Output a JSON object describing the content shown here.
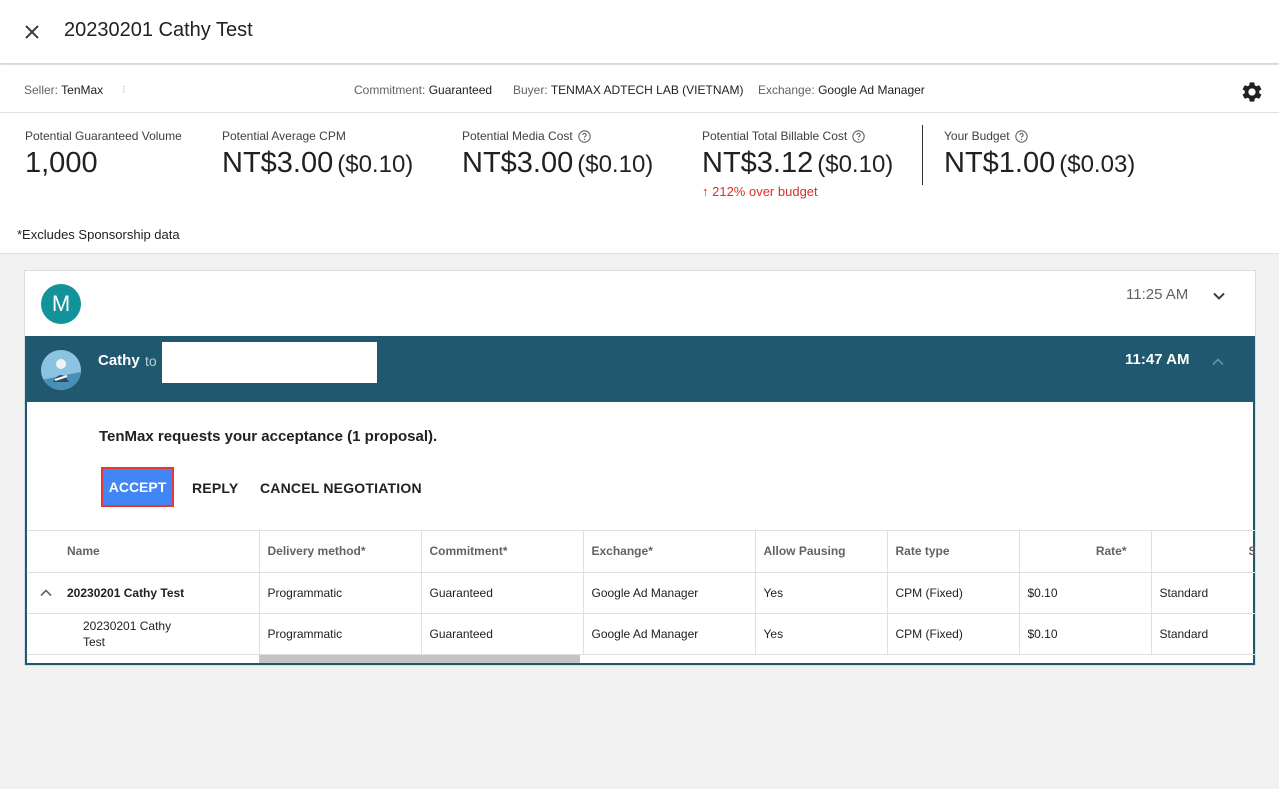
{
  "header": {
    "title": "20230201 Cathy Test"
  },
  "meta": {
    "seller_label": "Seller:",
    "seller_value": "TenMax",
    "commitment_label": "Commitment:",
    "commitment_value": "Guaranteed",
    "buyer_label": "Buyer:",
    "buyer_value": "TENMAX ADTECH LAB (VIETNAM)",
    "exchange_label": "Exchange:",
    "exchange_value": "Google Ad Manager"
  },
  "stats": {
    "volume_label": "Potential Guaranteed Volume",
    "volume_value": "1,000",
    "cpm_label": "Potential Average CPM",
    "cpm_value": "NT$3.00",
    "cpm_sub": "($0.10)",
    "media_label": "Potential Media Cost",
    "media_value": "NT$3.00",
    "media_sub": "($0.10)",
    "billable_label": "Potential Total Billable Cost",
    "billable_value": "NT$3.12",
    "billable_sub": "($0.10)",
    "over_budget": "↑ 212% over budget",
    "budget_label": "Your Budget",
    "budget_value": "NT$1.00",
    "budget_sub": "($0.03)",
    "excludes_note": "*Excludes Sponsorship data"
  },
  "messages": [
    {
      "avatar_letter": "M",
      "time": "11:25 AM"
    },
    {
      "sender": "Cathy",
      "to_label": "to",
      "time": "11:47 AM"
    }
  ],
  "request": {
    "text": "TenMax requests your acceptance (1 proposal).",
    "accept_label": "ACCEPT",
    "reply_label": "REPLY",
    "cancel_label": "CANCEL NEGOTIATION"
  },
  "table": {
    "headers": [
      "Name",
      "Delivery method*",
      "Commitment*",
      "Exchange*",
      "Allow Pausing",
      "Rate type",
      "Rate*",
      "Share of v"
    ],
    "rows": [
      [
        "20230201 Cathy Test",
        "Programmatic",
        "Guaranteed",
        "Google Ad Manager",
        "Yes",
        "CPM (Fixed)",
        "$0.10",
        "Standard"
      ],
      [
        "20230201 Cathy Test",
        "Programmatic",
        "Guaranteed",
        "Google Ad Manager",
        "Yes",
        "CPM (Fixed)",
        "$0.10",
        "Standard"
      ]
    ]
  },
  "colors": {
    "accent": "#4285f4",
    "header_bar": "#20586f",
    "avatar_m": "#12939a",
    "warning": "#d93025"
  },
  "icons": [
    "close-icon",
    "gear-icon",
    "help-icon",
    "chevron-down-icon",
    "chevron-up-icon",
    "expand-less-icon"
  ]
}
